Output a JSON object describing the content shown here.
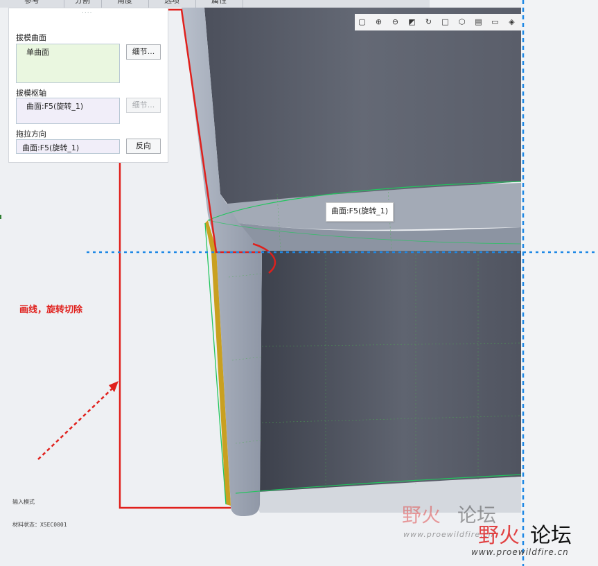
{
  "tabs": [
    "参考",
    "分割",
    "角度",
    "选项",
    "属性"
  ],
  "panel": {
    "grip": "....",
    "draft_surface_label": "拔模曲面",
    "draft_surface_value": "单曲面",
    "draft_surface_button": "细节...",
    "draft_hinge_label": "拔模枢轴",
    "draft_hinge_value": "曲面:F5(旋转_1)",
    "draft_hinge_button": "细节...",
    "pull_direction_label": "拖拉方向",
    "pull_direction_value": "曲面:F5(旋转_1)",
    "pull_direction_button": "反向"
  },
  "tooltip": "曲面:F5(旋转_1)",
  "annotation": "画线，旋转切除",
  "drawing_notes": [
    "输入模式",
    "材料状态：XSEC0001"
  ],
  "watermark": {
    "brand_red": "野火",
    "brand_dark": "论坛",
    "url": "www.proewildfire.cn"
  },
  "colors": {
    "annotation_red": "#e0201c",
    "guide_blue": "#1e88e5",
    "selection_green": "#22c55e",
    "model_gray": "#5a5f6c"
  },
  "toolbar_icons": [
    "zoom-fit-icon",
    "zoom-in-icon",
    "zoom-out-icon",
    "reorient-icon",
    "spin-icon",
    "saved-views-icon",
    "display-style-icon",
    "datum-display-icon",
    "view-manager-icon",
    "appearance-icon"
  ]
}
